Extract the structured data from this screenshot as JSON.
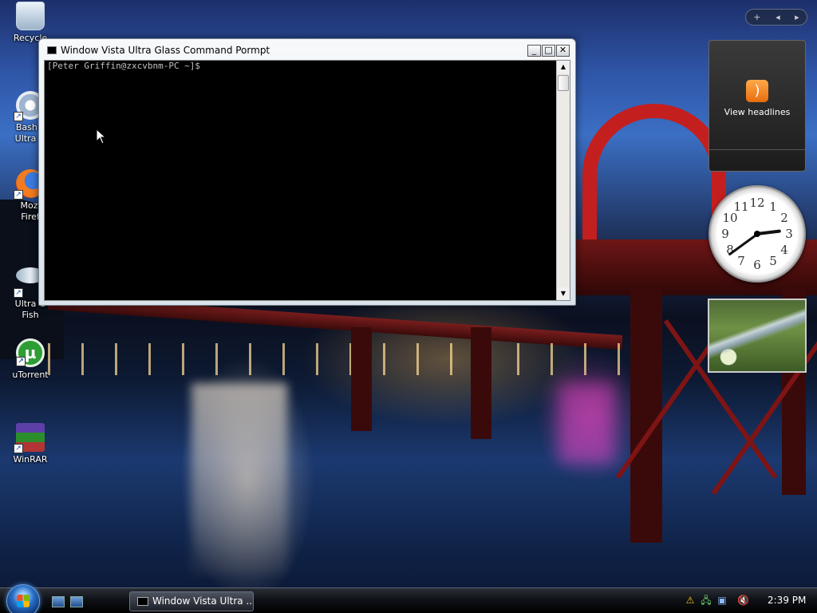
{
  "desktop": {
    "icons": [
      {
        "label": "Recycle"
      },
      {
        "label": "Bash s\nUltra G"
      },
      {
        "label": "Mozi\nFiref"
      },
      {
        "label": "Ultra G\nFish"
      },
      {
        "label": "uTorrent"
      },
      {
        "label": "WinRAR"
      }
    ],
    "utorrent_glyph": "µ"
  },
  "sidebar_controls": {
    "add": "+",
    "prev": "◂",
    "next": "▸"
  },
  "gadgets": {
    "feed": {
      "label": "View headlines",
      "icon": "rss-icon"
    },
    "clock": {
      "numbers": [
        "12",
        "1",
        "2",
        "3",
        "4",
        "5",
        "6",
        "7",
        "8",
        "9",
        "10",
        "11"
      ],
      "time_shown": "2:39"
    }
  },
  "window": {
    "title": "Window Vista Ultra Glass Command Pormpt",
    "min_glyph": "_",
    "max_glyph": "□",
    "close_glyph": "✕",
    "prompt": "[Peter Griffin@zxcvbnm-PC ~]$",
    "scroll_up": "▲",
    "scroll_down": "▼"
  },
  "taskbar": {
    "task_label": "Window Vista Ultra ...",
    "tray": {
      "shield": "⚠",
      "network": "🖧",
      "volume": "🔇"
    },
    "time": "2:39 PM"
  }
}
